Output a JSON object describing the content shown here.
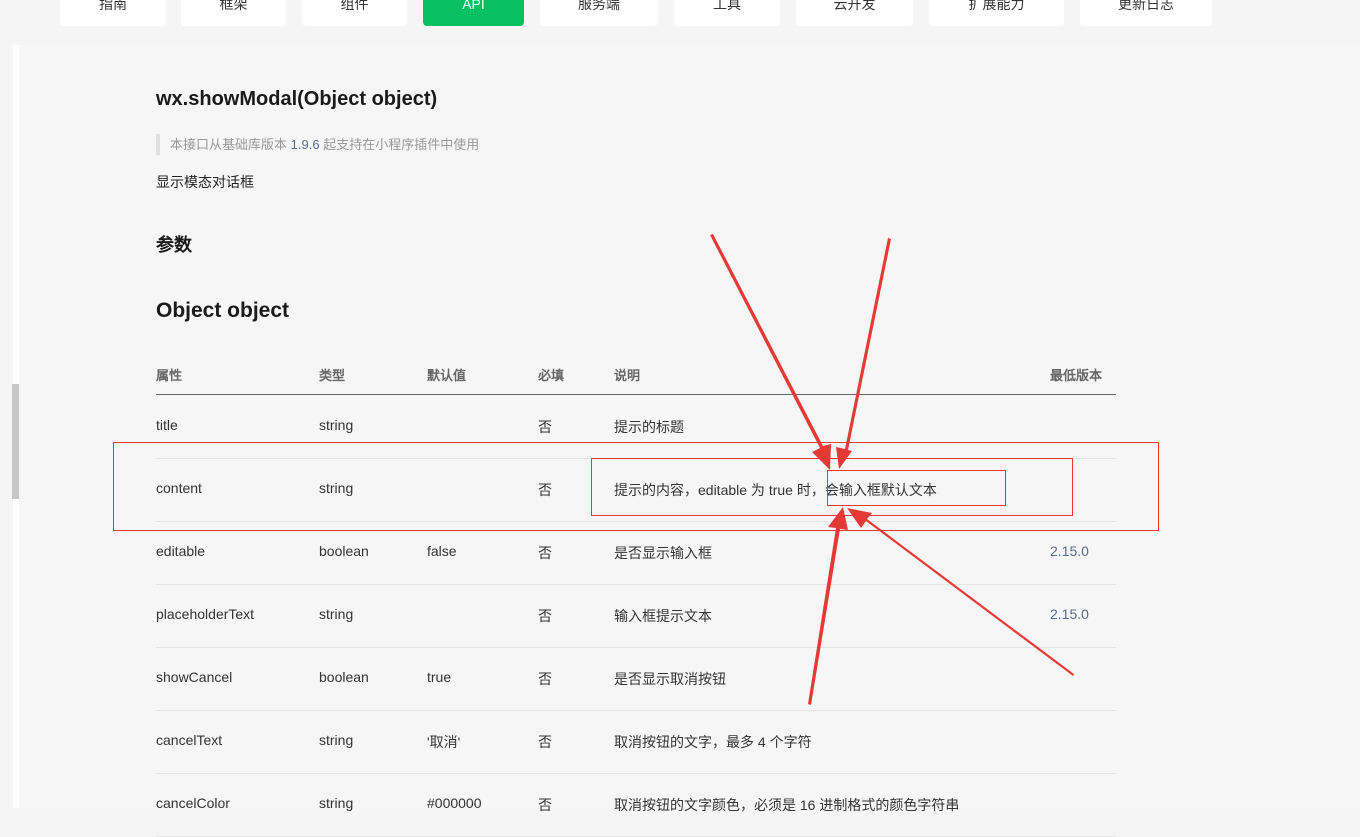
{
  "nav": {
    "tabs": [
      {
        "label": "指南",
        "active": false
      },
      {
        "label": "框架",
        "active": false
      },
      {
        "label": "组件",
        "active": false
      },
      {
        "label": "API",
        "active": true
      },
      {
        "label": "服务端",
        "active": false
      },
      {
        "label": "工具",
        "active": false
      },
      {
        "label": "云开发",
        "active": false
      },
      {
        "label": "扩展能力",
        "active": false
      },
      {
        "label": "更新日志",
        "active": false
      }
    ],
    "accent_color": "#07c160"
  },
  "page": {
    "title": "wx.showModal(Object object)",
    "support_note_prefix": "本接口从基础库版本",
    "support_note_version": "1.9.6",
    "support_note_suffix": "起支持在小程序插件中使用",
    "description": "显示模态对话框",
    "params_heading": "参数",
    "object_heading": "Object object"
  },
  "table": {
    "headers": [
      "属性",
      "类型",
      "默认值",
      "必填",
      "说明",
      "最低版本"
    ],
    "rows": [
      {
        "name": "title",
        "type": "string",
        "default": "",
        "required": "否",
        "desc": "提示的标题",
        "min_version": ""
      },
      {
        "name": "content",
        "type": "string",
        "default": "",
        "required": "否",
        "desc": "提示的内容，editable 为 true 时，会输入框默认文本",
        "min_version": ""
      },
      {
        "name": "editable",
        "type": "boolean",
        "default": "false",
        "required": "否",
        "desc": "是否显示输入框",
        "min_version": "2.15.0"
      },
      {
        "name": "placeholderText",
        "type": "string",
        "default": "",
        "required": "否",
        "desc": "输入框提示文本",
        "min_version": "2.15.0"
      },
      {
        "name": "showCancel",
        "type": "boolean",
        "default": "true",
        "required": "否",
        "desc": "是否显示取消按钮",
        "min_version": ""
      },
      {
        "name": "cancelText",
        "type": "string",
        "default": "'取消'",
        "required": "否",
        "desc": "取消按钮的文字，最多 4 个字符",
        "min_version": ""
      },
      {
        "name": "cancelColor",
        "type": "string",
        "default": "#000000",
        "required": "否",
        "desc": "取消按钮的文字颜色，必须是 16 进制格式的颜色字符串",
        "min_version": ""
      }
    ]
  },
  "annotation_color": "#e53935"
}
